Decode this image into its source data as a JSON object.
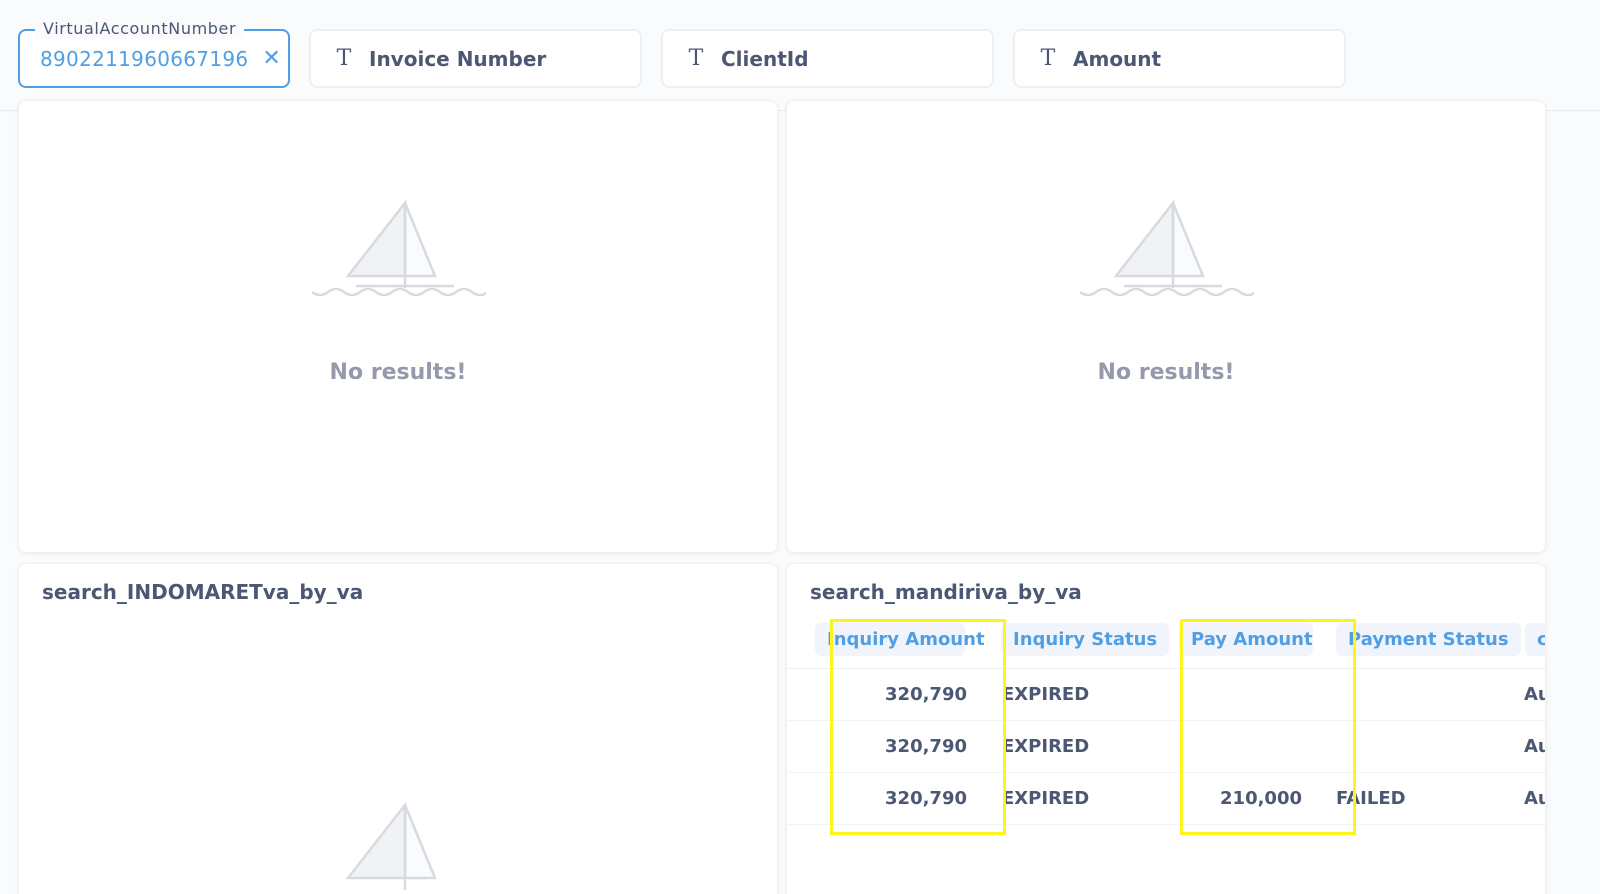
{
  "filters": {
    "virtual_account": {
      "label": "VirtualAccountNumber",
      "value": "8902211960667196",
      "clear_icon": "close-icon"
    },
    "invoice_number": {
      "label": "Invoice Number",
      "icon": "text-type-icon"
    },
    "client_id": {
      "label": "ClientId",
      "icon": "text-type-icon"
    },
    "amount": {
      "label": "Amount",
      "icon": "text-type-icon"
    }
  },
  "cards": {
    "top_left": {
      "empty_message": "No results!"
    },
    "top_right": {
      "empty_message": "No results!"
    },
    "bottom_left": {
      "title": "search_INDOMARETva_by_va"
    },
    "bottom_right": {
      "title": "search_mandiriva_by_va",
      "columns": [
        "Inquiry Amount",
        "Inquiry Status",
        "Pay Amount",
        "Payment Status",
        "c"
      ],
      "rows": [
        {
          "inquiry_amount": "320,790",
          "inquiry_status": "EXPIRED",
          "pay_amount": "",
          "payment_status": "",
          "extra": "Au"
        },
        {
          "inquiry_amount": "320,790",
          "inquiry_status": "EXPIRED",
          "pay_amount": "",
          "payment_status": "",
          "extra": "Au"
        },
        {
          "inquiry_amount": "320,790",
          "inquiry_status": "EXPIRED",
          "pay_amount": "210,000",
          "payment_status": "FAILED",
          "extra": "Au"
        }
      ]
    }
  },
  "colors": {
    "accent": "#509ee3",
    "text": "#4c5773",
    "muted": "#949aab",
    "highlight": "#fdf31f"
  }
}
